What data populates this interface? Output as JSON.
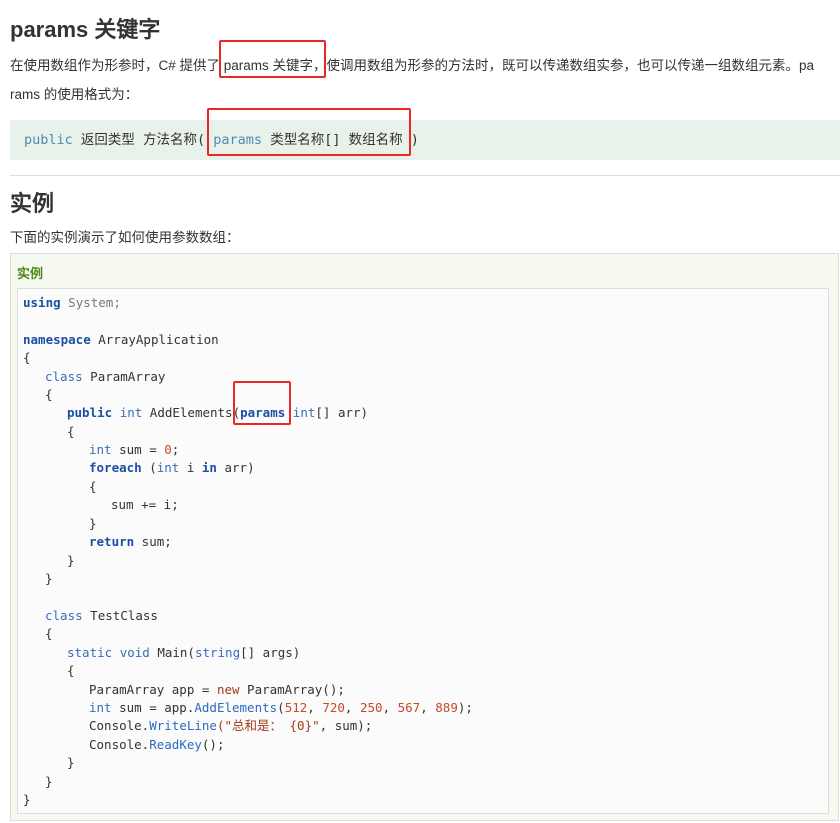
{
  "section1": {
    "title": "params 关键字",
    "para_line1_before": "在使用数组作为形参时，C# 提供了 ",
    "para_line1_highlight": "params 关键字",
    "para_line1_after": "，使调用数组为形参的方法时，既可以传递数组实参，也可以传递一组数组元素。pa",
    "para_line2": "rams 的使用格式为："
  },
  "syntax": {
    "public": "public",
    "return_method": " 返回类型 方法名称( ",
    "params": "params",
    "type_array": " 类型名称[] 数组名称",
    "close": " )"
  },
  "section2": {
    "title": "实例",
    "desc": "下面的实例演示了如何使用参数数组："
  },
  "example": {
    "label": "实例",
    "code": {
      "l1_using": "using",
      "l1_system": " System;",
      "l3_namespace": "namespace",
      "l3_name": " ArrayApplication",
      "brace_open": "{",
      "brace_close": "}",
      "l5_class": "class",
      "l5_name": " ParamArray",
      "l7_public": "public",
      "l7_int": "int",
      "l7_addelements": " AddElements(",
      "l7_params": "params",
      "l7_int2": "int",
      "l7_arr": "[] arr)",
      "l9_int": "int",
      "l9_sum": " sum = ",
      "l9_zero": "0",
      "semicolon": ";",
      "l10_foreach": "foreach",
      "l10_open": " (",
      "l10_int": "int",
      "l10_i": " i ",
      "l10_in": "in",
      "l10_arr": " arr)",
      "l12_sum": "sum += i;",
      "l14_return": "return",
      "l14_sum": " sum;",
      "l18_class": "class",
      "l18_name": " TestClass",
      "l20_static": "static",
      "l20_void": "void",
      "l20_main": " Main(",
      "l20_string": "string",
      "l20_args": "[] args)",
      "l22_a": "ParamArray app = ",
      "l22_new": "new",
      "l22_b": " ParamArray();",
      "l23_int": "int",
      "l23_a": " sum = app.",
      "l23_add": "AddElements",
      "l23_open": "(",
      "l23_n1": "512",
      "l23_n2": "720",
      "l23_n3": "250",
      "l23_n4": "567",
      "l23_n5": "889",
      "comma": ", ",
      "l23_close": ");",
      "l24_console": "Console.",
      "l24_writeline": "WriteLine",
      "l24_str": "(\"总和是： {0}\"",
      "l24_rest": ", sum);",
      "l25_console": "Console.",
      "l25_readkey": "ReadKey",
      "l25_rest": "();"
    }
  }
}
